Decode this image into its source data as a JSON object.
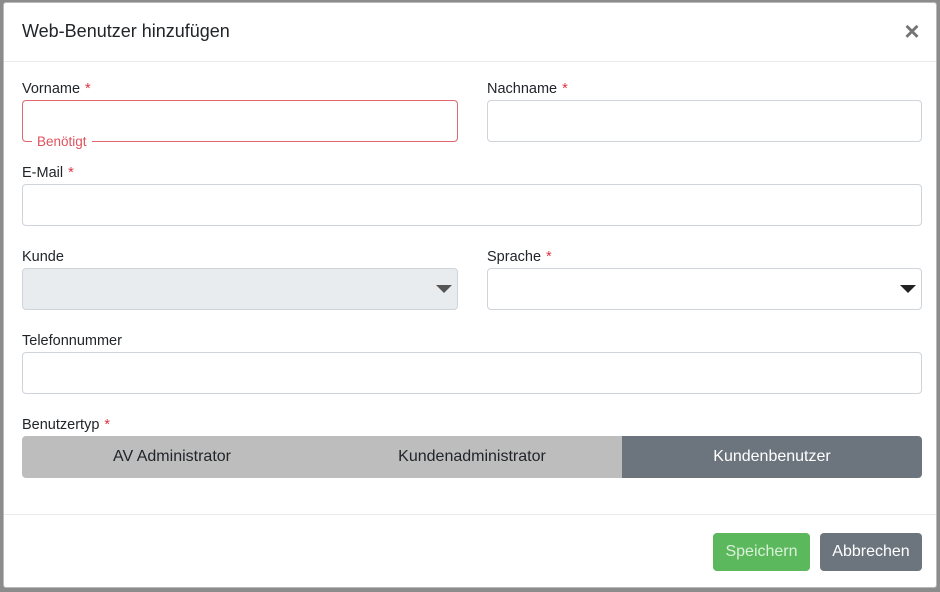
{
  "modal": {
    "title": "Web-Benutzer hinzufügen",
    "close_symbol": "×"
  },
  "form": {
    "required_marker": "*",
    "vorname": {
      "label": "Vorname",
      "value": "",
      "error": "Benötigt"
    },
    "nachname": {
      "label": "Nachname",
      "value": ""
    },
    "email": {
      "label": "E-Mail",
      "value": ""
    },
    "kunde": {
      "label": "Kunde",
      "value": ""
    },
    "sprache": {
      "label": "Sprache",
      "value": ""
    },
    "telefon": {
      "label": "Telefonnummer",
      "value": ""
    },
    "benutzertyp": {
      "label": "Benutzertyp",
      "options": [
        "AV Administrator",
        "Kundenadministrator",
        "Kundenbenutzer"
      ],
      "selected": "Kundenbenutzer"
    }
  },
  "footer": {
    "save_label": "Speichern",
    "cancel_label": "Abbrechen"
  },
  "colors": {
    "error": "#dc3545",
    "save_button": "#5cb85c",
    "cancel_button": "#6c757d",
    "toggle_active": "#6c757d",
    "toggle_inactive": "#bdbdbd"
  }
}
